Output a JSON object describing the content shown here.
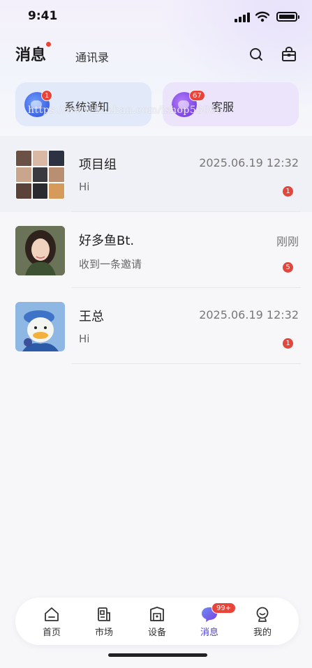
{
  "status_bar": {
    "time": "9:41"
  },
  "header": {
    "title": "消息",
    "contacts_tab": "通讯录"
  },
  "quick_cards": [
    {
      "label": "系统通知",
      "badge": "1",
      "icon": "notification-bubble-icon",
      "color": "#3e62e8"
    },
    {
      "label": "客服",
      "badge": "67",
      "icon": "service-bubble-icon",
      "color": "#7c45e9"
    }
  ],
  "watermark": "https://www.huzhan.com/ishop53066",
  "chats": [
    {
      "name": "项目组",
      "time": "2025.06.19 12:32",
      "preview": "Hi",
      "badge": "1"
    },
    {
      "name": "好多鱼Bt.",
      "time": "刚刚",
      "preview": "收到一条邀请",
      "badge": "5"
    },
    {
      "name": "王总",
      "time": "2025.06.19 12:32",
      "preview": "Hi",
      "badge": "1"
    }
  ],
  "tab_bar": {
    "tabs": [
      {
        "label": "首页",
        "icon": "home-icon"
      },
      {
        "label": "市场",
        "icon": "market-icon"
      },
      {
        "label": "设备",
        "icon": "device-icon"
      },
      {
        "label": "消息",
        "icon": "message-icon",
        "badge": "99+",
        "active": true
      },
      {
        "label": "我的",
        "icon": "profile-icon"
      }
    ]
  },
  "colors": {
    "accent": "#4b3fd6",
    "badge": "#e8443a"
  }
}
